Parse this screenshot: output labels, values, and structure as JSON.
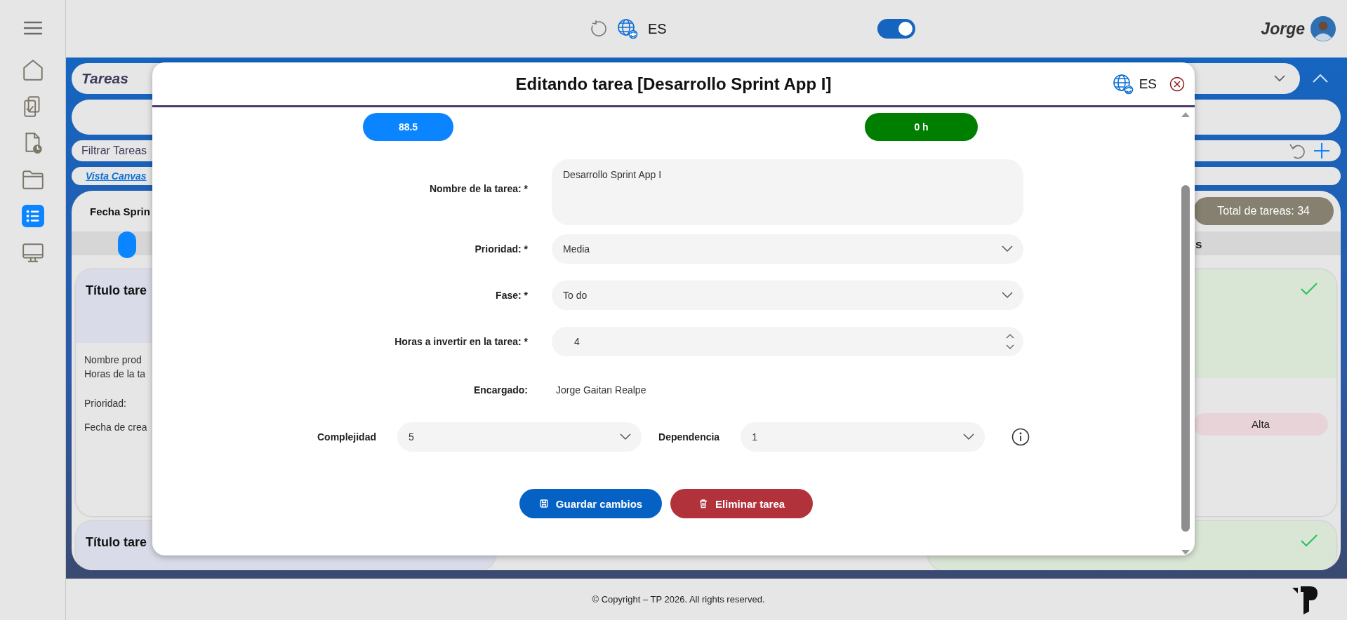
{
  "top_bar": {
    "language": "ES",
    "toggle": {
      "on": true
    },
    "user": "Jorge"
  },
  "sidebar": {
    "items": [
      {
        "kind": "home",
        "selected": false
      },
      {
        "kind": "clipboard",
        "selected": false
      },
      {
        "kind": "report",
        "selected": false
      },
      {
        "kind": "folder",
        "selected": false
      },
      {
        "kind": "list",
        "selected": true
      },
      {
        "kind": "monitor",
        "selected": false
      }
    ]
  },
  "page": {
    "title": "Tareas",
    "filter_label": "Filtrar Tareas",
    "link": "Vista Canvas",
    "board": {
      "header_label": "Fecha Sprin",
      "total": "Total de tareas: 34",
      "column_3_heading": "s",
      "cards": [
        {
          "kind": "summary",
          "title": "Título tare",
          "lines": [
            "Nombre prod",
            "Horas de la ta"
          ],
          "fields": [
            "Prioridad:",
            "Fecha de crea"
          ]
        },
        {
          "kind": "status",
          "done": true,
          "priority": "Alta"
        },
        {
          "kind": "summary",
          "title": "Título tare"
        },
        {
          "kind": "status",
          "done": true
        }
      ]
    }
  },
  "dialog": {
    "title": "Editando tarea [Desarrollo Sprint App I]",
    "language": "ES",
    "stats": [
      {
        "kind": "primary",
        "value": "88.5"
      },
      {
        "kind": "success",
        "value": "0 h"
      }
    ],
    "fields": [
      {
        "kind": "textarea",
        "label": "Nombre de la tarea: *",
        "value": "Desarrollo Sprint App I"
      },
      {
        "kind": "select",
        "label": "Prioridad: *",
        "value": "Media"
      },
      {
        "kind": "select",
        "label": "Fase: *",
        "value": "To do"
      },
      {
        "kind": "number",
        "label": "Horas a invertir en la tarea: *",
        "value": "4"
      },
      {
        "kind": "text",
        "label": "Encargado:",
        "value": "Jorge Gaitan Realpe"
      }
    ],
    "inline_fields": [
      {
        "label": "Complejidad",
        "value": "5"
      },
      {
        "label": "Dependencia",
        "value": "1"
      }
    ],
    "buttons": [
      {
        "kind": "save",
        "label": "Guardar cambios"
      },
      {
        "kind": "delete",
        "label": "Eliminar tarea"
      }
    ]
  },
  "footer": {
    "copyright": "© Copyright – TP 2026. All rights reserved."
  }
}
